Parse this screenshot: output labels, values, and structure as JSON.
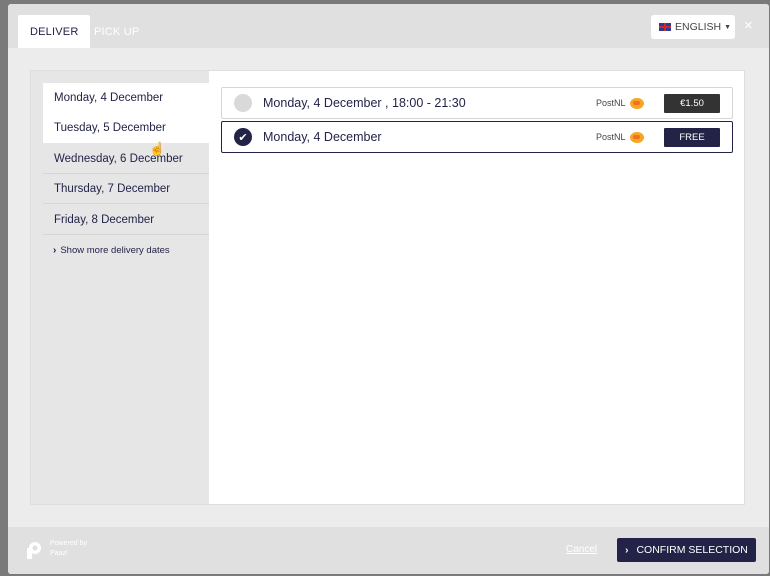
{
  "tabs": {
    "deliver": "DELIVER",
    "pickup": "PICK UP"
  },
  "language": {
    "label": "ENGLISH",
    "flag_icon": "uk-flag-icon"
  },
  "close_icon": "×",
  "dates": [
    {
      "label": "Monday, 4 December"
    },
    {
      "label": "Tuesday, 5 December"
    },
    {
      "label": "Wednesday, 6 December"
    },
    {
      "label": "Thursday, 7 December"
    },
    {
      "label": "Friday, 8 December"
    }
  ],
  "show_more": "Show more delivery dates",
  "options": [
    {
      "label": "Monday, 4 December , 18:00 - 21:30",
      "carrier": "PostNL",
      "price": "€1.50",
      "selected": false
    },
    {
      "label": "Monday, 4 December",
      "carrier": "PostNL",
      "price": "FREE",
      "selected": true
    }
  ],
  "footer": {
    "powered_line1": "Powered by",
    "powered_line2": "Paazl",
    "cancel": "Cancel",
    "confirm": "CONFIRM SELECTION"
  },
  "colors": {
    "navy": "#232348",
    "dark_price": "#333333",
    "header_bg": "#e0e0e0"
  }
}
